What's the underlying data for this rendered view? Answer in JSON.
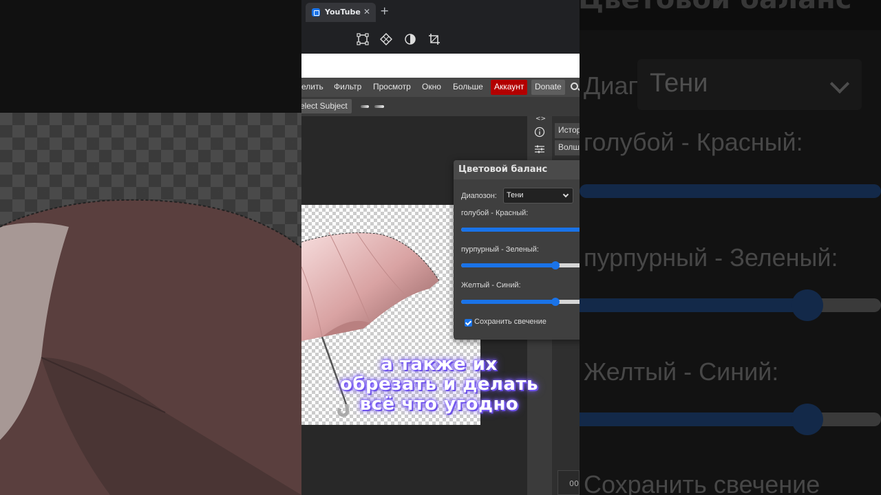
{
  "browser": {
    "tab_title": "YouTube",
    "tab_close": "✕",
    "new_tab": "+"
  },
  "menubar": {
    "items": [
      "елить",
      "Фильтр",
      "Просмотр",
      "Окно",
      "Больше"
    ],
    "account": "Аккаунт",
    "donate": "Donate"
  },
  "optbar": {
    "select_subject": "elect Subject"
  },
  "side_panel": {
    "collapse": "<>",
    "tabs": [
      "Истор",
      "Волше"
    ],
    "bottom_value": "00"
  },
  "dialog": {
    "title": "Цветовой баланс",
    "range_label": "Диапозон:",
    "range_value": "Тени",
    "sliders": [
      {
        "label": "голубой - Красный:",
        "value": 1.0
      },
      {
        "label": "пурпурный - Зеленый:",
        "value": 0.72
      },
      {
        "label": "Желтый - Синий:",
        "value": 0.72
      }
    ],
    "preserve_label": "Сохранить свечение",
    "preserve_checked": true
  },
  "caption": {
    "lines": [
      "а также их",
      "обрезать и делать",
      "всё что угодно"
    ]
  },
  "background_zoom": {
    "title": "Цветовой баланс",
    "range_label": "Диапозон:",
    "range_value": "Тени",
    "slider1": "голубой - Красный:",
    "slider2": "пурпурный - Зеленый:",
    "slider3": "Желтый - Синий:",
    "preserve": "Сохранить свечение"
  },
  "colors": {
    "accent": "#1a73e8",
    "account_bg": "#b30000",
    "caption_glow": "#7b5cff"
  }
}
